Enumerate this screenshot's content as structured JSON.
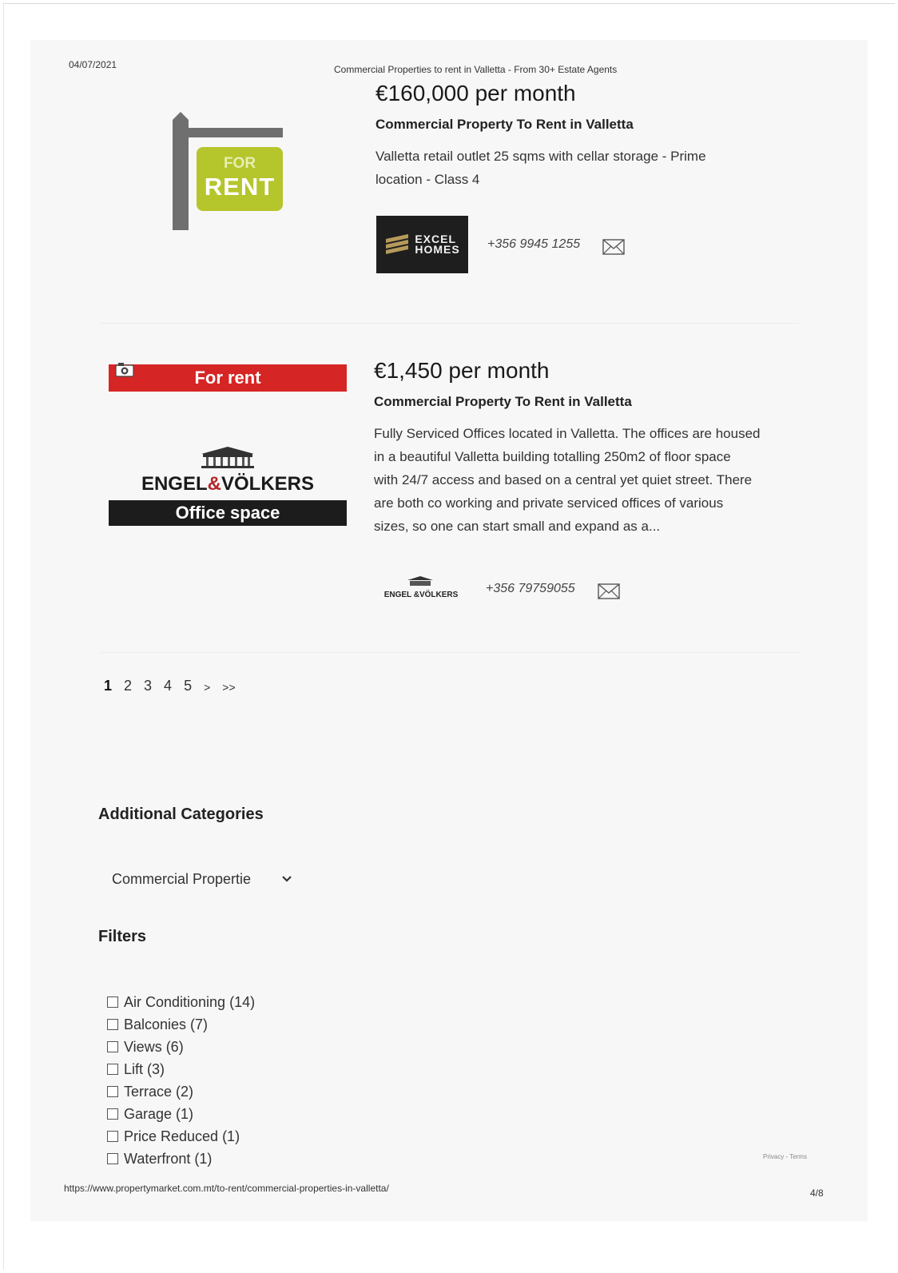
{
  "print_header": {
    "date": "04/07/2021",
    "title": "Commercial Properties to rent in Valletta - From 30+ Estate Agents"
  },
  "listings": [
    {
      "price": "€160,000 per month",
      "subtitle": "Commercial Property To Rent in Valletta",
      "description_lines": [
        "Valletta retail outlet 25 sqms with cellar storage - Prime",
        "location - Class 4"
      ],
      "image": {
        "sign_top": "FOR",
        "sign_main": "RENT",
        "sign_color": "#b5c52c"
      },
      "agency": {
        "logo_line1": "EXCEL",
        "logo_line2": "HOMES"
      },
      "phone": "+356 9945 1255"
    },
    {
      "price": "€1,450 per month",
      "subtitle": "Commercial Property To Rent in Valletta",
      "description_lines": [
        "Fully Serviced Offices located in Valletta. The offices are housed",
        "in a beautiful Valletta building totalling 250m2 of floor space",
        "with 24/7 access and based on a central yet quiet street. There",
        "are both co working and private serviced offices of various",
        "sizes, so one can start small and expand as a..."
      ],
      "image": {
        "banner_top": "For rent",
        "brand_left": "ENGEL",
        "brand_amp": "&",
        "brand_right": "VÖLKERS",
        "banner_bottom": "Office space"
      },
      "agency": {
        "logo_text": "ENGEL &VÖLKERS"
      },
      "phone": "+356 79759055"
    }
  ],
  "pagination": {
    "pages": [
      "1",
      "2",
      "3",
      "4",
      "5"
    ],
    "next": ">",
    "last": ">>"
  },
  "sidebar": {
    "categories_heading": "Additional Categories",
    "category_select": "Commercial Propertie",
    "filters_heading": "Filters",
    "filters": [
      "Air Conditioning (14)",
      "Balconies (7)",
      "Views (6)",
      "Lift (3)",
      "Terrace (2)",
      "Garage (1)",
      "Price Reduced (1)",
      "Waterfront (1)"
    ]
  },
  "recaptcha_text": "Privacy - Terms",
  "print_footer": {
    "url": "https://www.propertymarket.com.mt/to-rent/commercial-properties-in-valletta/",
    "page": "4/8"
  }
}
